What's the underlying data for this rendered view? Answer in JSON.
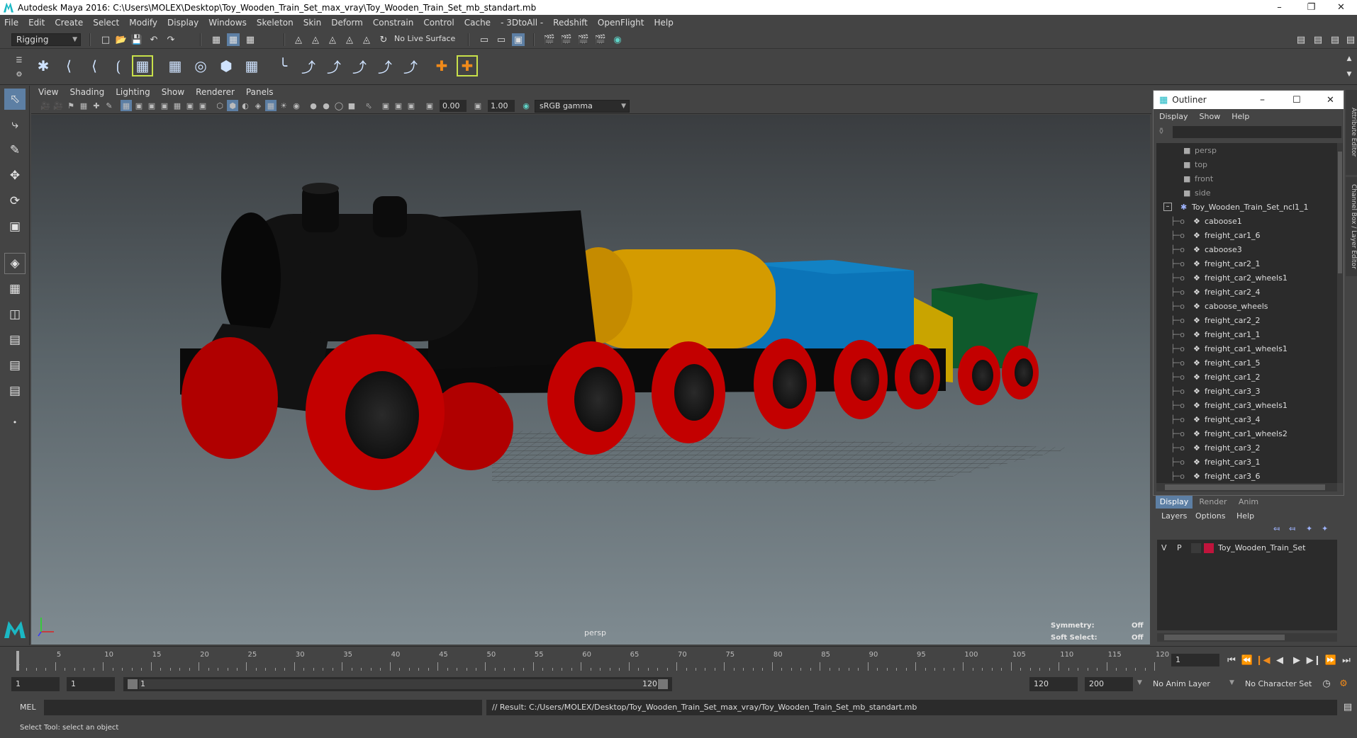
{
  "window": {
    "title": "Autodesk Maya 2016: C:\\Users\\MOLEX\\Desktop\\Toy_Wooden_Train_Set_max_vray\\Toy_Wooden_Train_Set_mb_standart.mb"
  },
  "menubar": [
    "File",
    "Edit",
    "Create",
    "Select",
    "Modify",
    "Display",
    "Windows",
    "Skeleton",
    "Skin",
    "Deform",
    "Constrain",
    "Control",
    "Cache",
    "- 3DtoAll -",
    "Redshift",
    "OpenFlight",
    "Help"
  ],
  "statusline": {
    "menuset": "Rigging",
    "live_surface": "No Live Surface"
  },
  "viewport": {
    "menu": [
      "View",
      "Shading",
      "Lighting",
      "Show",
      "Renderer",
      "Panels"
    ],
    "exposure": "0.00",
    "gamma": "1.00",
    "color_space": "sRGB gamma",
    "camera_label": "persp",
    "symmetry_label": "Symmetry:",
    "symmetry_value": "Off",
    "soft_select_label": "Soft Select:",
    "soft_select_value": "Off"
  },
  "outliner": {
    "title": "Outliner",
    "menu": [
      "Display",
      "Show",
      "Help"
    ],
    "cameras": [
      "persp",
      "top",
      "front",
      "side"
    ],
    "group": "Toy_Wooden_Train_Set_ncl1_1",
    "children": [
      "caboose1",
      "freight_car1_6",
      "caboose3",
      "freight_car2_1",
      "freight_car2_wheels1",
      "freight_car2_4",
      "caboose_wheels",
      "freight_car2_2",
      "freight_car1_1",
      "freight_car1_wheels1",
      "freight_car1_5",
      "freight_car1_2",
      "freight_car3_3",
      "freight_car3_wheels1",
      "freight_car3_4",
      "freight_car1_wheels2",
      "freight_car3_2",
      "freight_car3_1",
      "freight_car3_6"
    ]
  },
  "layers": {
    "tabs": [
      "Display",
      "Render",
      "Anim"
    ],
    "menu": [
      "Layers",
      "Options",
      "Help"
    ],
    "row": {
      "v": "V",
      "p": "P",
      "name": "Toy_Wooden_Train_Set",
      "color": "#c0143c"
    }
  },
  "timeline": {
    "ticks": [
      "5",
      "10",
      "15",
      "20",
      "25",
      "30",
      "35",
      "40",
      "45",
      "50",
      "55",
      "60",
      "65",
      "70",
      "75",
      "80",
      "85",
      "90",
      "95",
      "100",
      "105",
      "110",
      "115",
      "120"
    ],
    "left_tick": "1",
    "current_frame": "1"
  },
  "range": {
    "start": "1",
    "playback_start": "1",
    "slider_start": "1",
    "slider_end": "120",
    "playback_end": "120",
    "end": "200",
    "anim_layer": "No Anim Layer",
    "character_set": "No Character Set"
  },
  "cmdline": {
    "label": "MEL",
    "result": "// Result: C:/Users/MOLEX/Desktop/Toy_Wooden_Train_Set_max_vray/Toy_Wooden_Train_Set_mb_standart.mb"
  },
  "helpline": "Select Tool: select an object"
}
